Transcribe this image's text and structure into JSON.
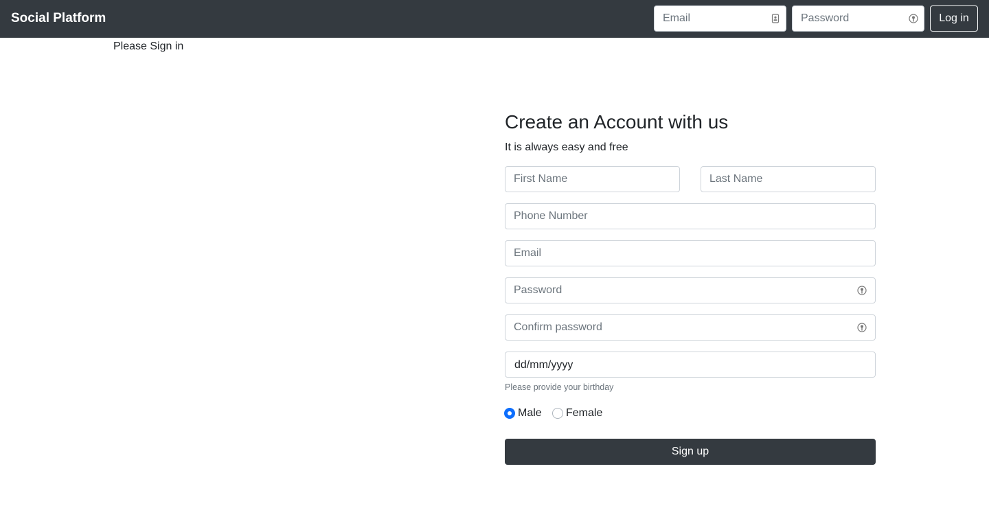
{
  "navbar": {
    "brand": "Social Platform",
    "email_placeholder": "Email",
    "password_placeholder": "Password",
    "login_label": "Log in",
    "bg_color": "#343a40",
    "email_icon": "contact-card-icon",
    "password_icon": "key-icon"
  },
  "left": {
    "signin_text": "Please Sign in"
  },
  "signup": {
    "title": "Create an Account with us",
    "subtitle": "It is always easy and free",
    "first_name_placeholder": "First Name",
    "last_name_placeholder": "Last Name",
    "phone_placeholder": "Phone Number",
    "email_placeholder": "Email",
    "password_placeholder": "Password",
    "confirm_placeholder": "Confirm password",
    "birthday_value": "dd/mm/yyyy",
    "birthday_help": "Please provide your birthday",
    "gender_options": [
      "Male",
      "Female"
    ],
    "gender_selected": "Male",
    "submit_label": "Sign up",
    "accent_color": "#0d6efd"
  }
}
